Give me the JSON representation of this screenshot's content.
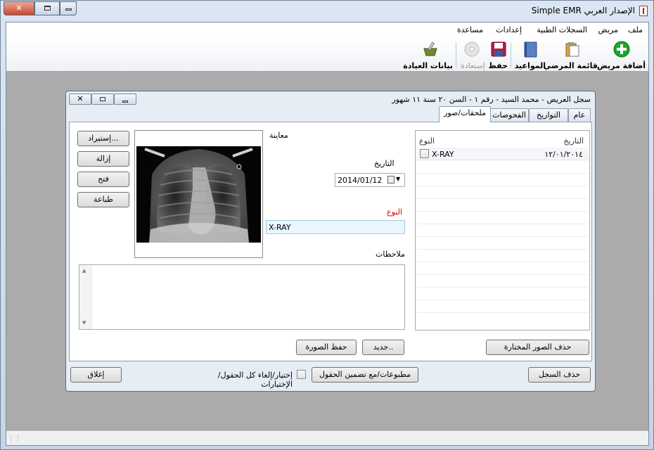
{
  "window": {
    "title": "الإصدار العربي Simple EMR"
  },
  "menu": [
    "ملف",
    "مريض",
    "السجلات الطبية",
    "إعدادات",
    "مساعدة"
  ],
  "toolbar": {
    "add_patient": "أضافة مريض",
    "patient_list": "قائمة المرضي",
    "appointments": "المواعيد",
    "save": "حفظ",
    "restore": "إستعادة",
    "clinic_data": "بيانات العيادة"
  },
  "record": {
    "title": "سجل العريض - محمد السيد - رقم ١ - السن ٢٠ سنة ١١ شهور",
    "tabs": [
      "عام",
      "التواريخ",
      "الفحوصات",
      "ملحقات/صور"
    ],
    "attachments": {
      "col_date": "التاريخ",
      "col_type": "النوع",
      "rows": [
        {
          "date": "١٢/٠١/٢٠١٤",
          "type": "X-RAY"
        }
      ],
      "delete_selected": "حذف الصور المختارة"
    },
    "preview_label": "معاينة",
    "buttons": {
      "import": "إستيراد...",
      "remove": "إزالة",
      "open": "فتح",
      "print": "طباعة"
    },
    "date_label": "التاريخ",
    "date_value": "2014/01/12",
    "type_label": "النوع",
    "type_value": "X-RAY",
    "notes_label": "ملاحظات",
    "new_button": "جديد..",
    "save_image_button": "حفظ الصورة",
    "delete_record": "حذف السجل",
    "print_with_fields": "مطبوعات/مع تضمين الحقول",
    "select_all_label": "إختيار/إلغاء كل الحقول/الإختيارات",
    "close_button": "إغلاق"
  },
  "colors": {
    "title_red": "#ff0000",
    "accent_green": "#1ea62c"
  }
}
